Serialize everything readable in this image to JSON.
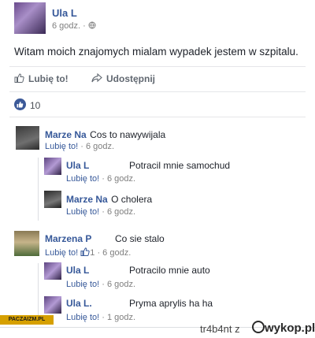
{
  "post": {
    "author": "Ula L",
    "time": "6 godz.",
    "visibility_icon": "globe-icon",
    "text": "Witam moich znajomych mialam wypadek jestem w szpitalu."
  },
  "actions": {
    "like_label": "Lubię to!",
    "share_label": "Udostępnij"
  },
  "reactions": {
    "count": "10",
    "icon": "thumbs-up-icon",
    "color": "#3b5998"
  },
  "comments": [
    {
      "author": "Marze Na",
      "text": "Cos to nawywijala",
      "like_label": "Lubię to!",
      "time": "6 godz.",
      "replies": [
        {
          "author": "Ula L",
          "text": "Potracil mnie samochud",
          "like_label": "Lubię to!",
          "time": "6 godz."
        },
        {
          "author": "Marze Na",
          "text": "O cholera",
          "like_label": "Lubię to!",
          "time": "6 godz."
        }
      ]
    },
    {
      "author": "Marzena P",
      "text": "Co sie stalo",
      "like_label": "Lubię to!",
      "like_count": "1",
      "time": "6 godz.",
      "replies": [
        {
          "author": "Ula L",
          "text": "Potracilo mnie auto",
          "like_label": "Lubię to!",
          "time": "6 godz."
        },
        {
          "author": "Ula L.",
          "text": "Pryma aprylis ha ha",
          "like_label": "Lubię to!",
          "time": "1 godz."
        }
      ]
    }
  ],
  "watermark": {
    "badge": "PACZAIZM.PL",
    "user": "tr4b4nt",
    "separator": "z",
    "site": "wykop.pl"
  }
}
